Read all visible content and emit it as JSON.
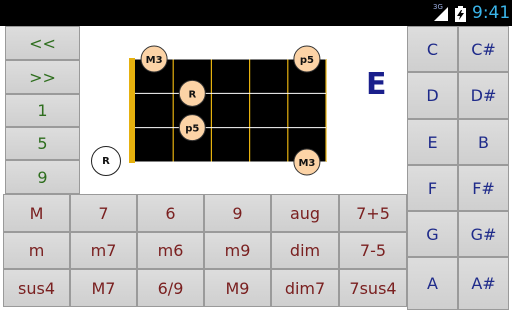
{
  "status_bar": {
    "network_label": "3G",
    "time": "9:41"
  },
  "nav_buttons": [
    "<<",
    ">>",
    "1",
    "5",
    "9"
  ],
  "chord_types": [
    [
      "M",
      "7",
      "6",
      "9",
      "aug",
      "7+5"
    ],
    [
      "m",
      "m7",
      "m6",
      "m9",
      "dim",
      "7-5"
    ],
    [
      "sus4",
      "M7",
      "6/9",
      "M9",
      "dim7",
      "7sus4"
    ]
  ],
  "notes": [
    [
      "C",
      "C#"
    ],
    [
      "D",
      "D#"
    ],
    [
      "E",
      "B"
    ],
    [
      "F",
      "F#"
    ],
    [
      "G",
      "G#"
    ],
    [
      "A",
      "A#"
    ]
  ],
  "diagram": {
    "key": "E",
    "open_string_marker": "R",
    "finger_markers": [
      {
        "label": "M3",
        "string": 4,
        "fret": 1
      },
      {
        "label": "p5",
        "string": 4,
        "fret": 5
      },
      {
        "label": "R",
        "string": 3,
        "fret": 2
      },
      {
        "label": "p5",
        "string": 2,
        "fret": 2
      },
      {
        "label": "M3",
        "string": 1,
        "fret": 5
      }
    ]
  },
  "colors": {
    "nav_text": "#2e6e1e",
    "chord_text": "#7a2020",
    "note_text": "#1f2b8a",
    "key_letter": "#1a1f8c",
    "nut": "#e6b10e",
    "fretboard": "#000000",
    "marker_fill": "#fcd3a6",
    "clock": "#3bb5ea"
  }
}
